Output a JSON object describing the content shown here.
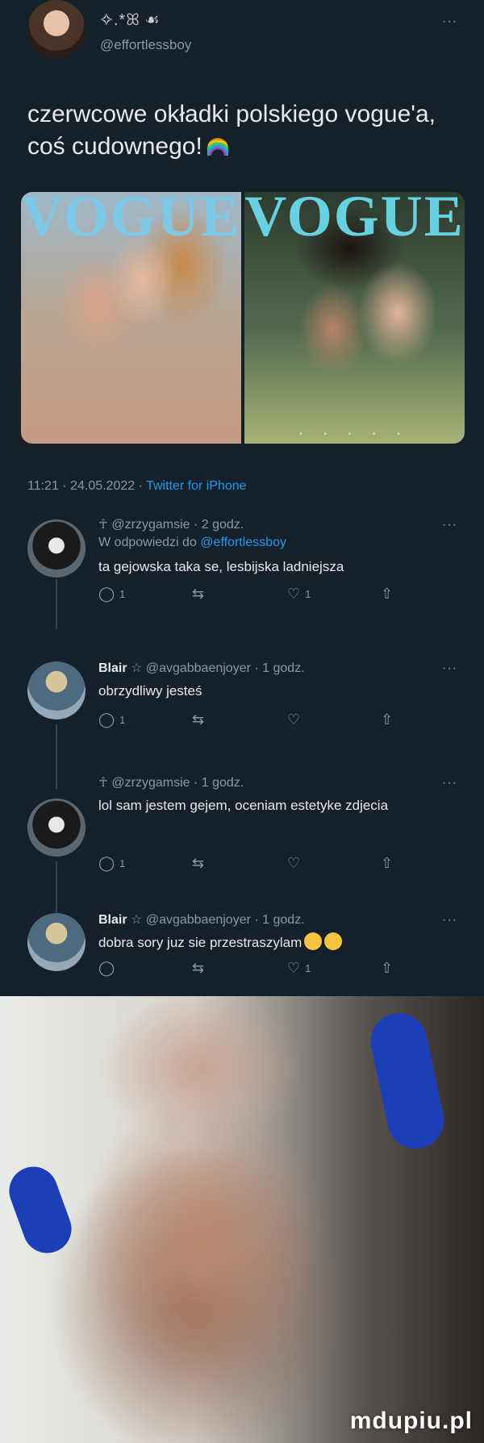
{
  "tweet": {
    "display_name": "✧.*ꕤ ☙",
    "handle": "@effortlessboy",
    "text": "czerwcowe okładki polskiego vogue'a, coś cudownego!",
    "timestamp": "11:21 · 24.05.2022 ·",
    "source": "Twitter for iPhone",
    "more": "···"
  },
  "media": {
    "cover_left_logo": "VOGUE",
    "cover_right_logo": "VOGUE",
    "dots": "• • • • •"
  },
  "replies": [
    {
      "name": "",
      "handle_time": "☥ @zrzygamsie · 2 godz.",
      "reply_to": "W odpowiedzi do",
      "reply_to_handle": "@effortlessboy",
      "text": "ta gejowska taka se, lesbijska ladniejsza",
      "comments": "1",
      "retweets": "",
      "likes": "1"
    },
    {
      "name": "Blair",
      "handle_time": "☆ @avgabbaenjoyer · 1 godz.",
      "text": "obrzydliwy jesteś",
      "comments": "1",
      "retweets": "",
      "likes": ""
    },
    {
      "name": "",
      "handle_time": "☥ @zrzygamsie · 1 godz.",
      "text": "lol sam jestem gejem, oceniam estetyke zdjecia",
      "comments": "1",
      "retweets": "",
      "likes": ""
    },
    {
      "name": "Blair",
      "handle_time": "☆ @avgabbaenjoyer · 1 godz.",
      "text": "dobra sory juz sie przestraszylam",
      "comments": "",
      "retweets": "",
      "likes": "1"
    }
  ],
  "icons": {
    "comment": "◯",
    "retweet": "⇆",
    "like": "♡",
    "share": "⇧"
  },
  "watermark": "mdupiu.pl",
  "colors": {
    "background": "#15202b",
    "link": "#1d9bf0",
    "muted": "#8b98a5"
  }
}
